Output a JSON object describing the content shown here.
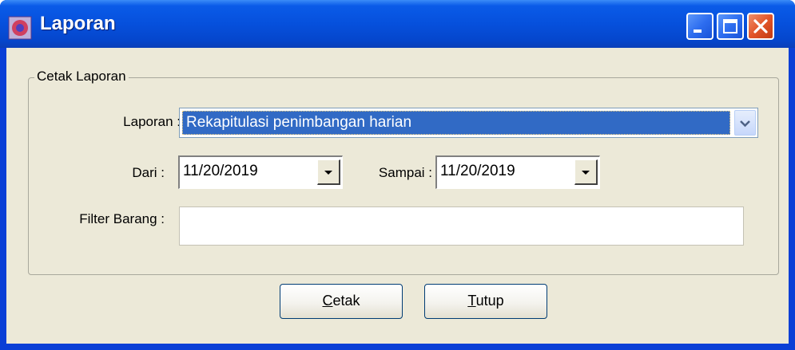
{
  "window": {
    "title": "Laporan",
    "icon": "app-icon",
    "controls": [
      "minimize-icon",
      "maximize-icon",
      "close-icon"
    ]
  },
  "group": {
    "legend": "Cetak Laporan"
  },
  "form": {
    "laporan_label": "Laporan :",
    "laporan_value": "Rekapitulasi penimbangan harian",
    "dari_label": "Dari :",
    "dari_value": "11/20/2019",
    "sampai_label": "Sampai :",
    "sampai_value": "11/20/2019",
    "filter_label": "Filter Barang :",
    "filter_value": ""
  },
  "buttons": {
    "cetak_mnemonic": "C",
    "cetak_rest": "etak",
    "tutup_mnemonic": "T",
    "tutup_rest": "utup"
  },
  "colors": {
    "titlebar": "#0650dc",
    "face": "#ece9d8",
    "selection": "#316ac5"
  }
}
